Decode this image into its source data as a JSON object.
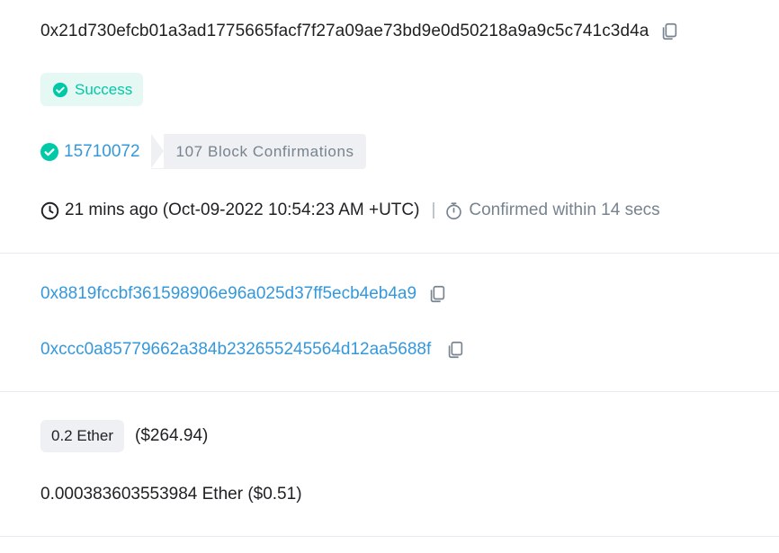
{
  "tx": {
    "hash": "0x21d730efcb01a3ad1775665facf7f27a09ae73bd9e0d50218a9a9c5c741c3d4a",
    "status": "Success",
    "block_number": "15710072",
    "confirmations": "107 Block Confirmations",
    "timestamp": "21 mins ago (Oct-09-2022 10:54:23 AM +UTC)",
    "separator": "|",
    "confirmed_within": "Confirmed within 14 secs"
  },
  "addresses": {
    "from": "0x8819fccbf361598906e96a025d37ff5ecb4eb4a9",
    "to": "0xccc0a85779662a384b232655245564d12aa5688f"
  },
  "amounts": {
    "value": "0.2 Ether",
    "value_usd": "($264.94)",
    "fee": "0.000383603553984 Ether ($0.51)"
  },
  "colors": {
    "link": "#3498db",
    "success": "#00c9a7",
    "success_bg": "#e6f8f3",
    "muted": "#77838f"
  },
  "icons": {
    "copy": "copy-icon",
    "status": "check-circle-icon",
    "block": "check-circle-icon",
    "time": "clock-icon",
    "confirm_time": "stopwatch-icon"
  }
}
